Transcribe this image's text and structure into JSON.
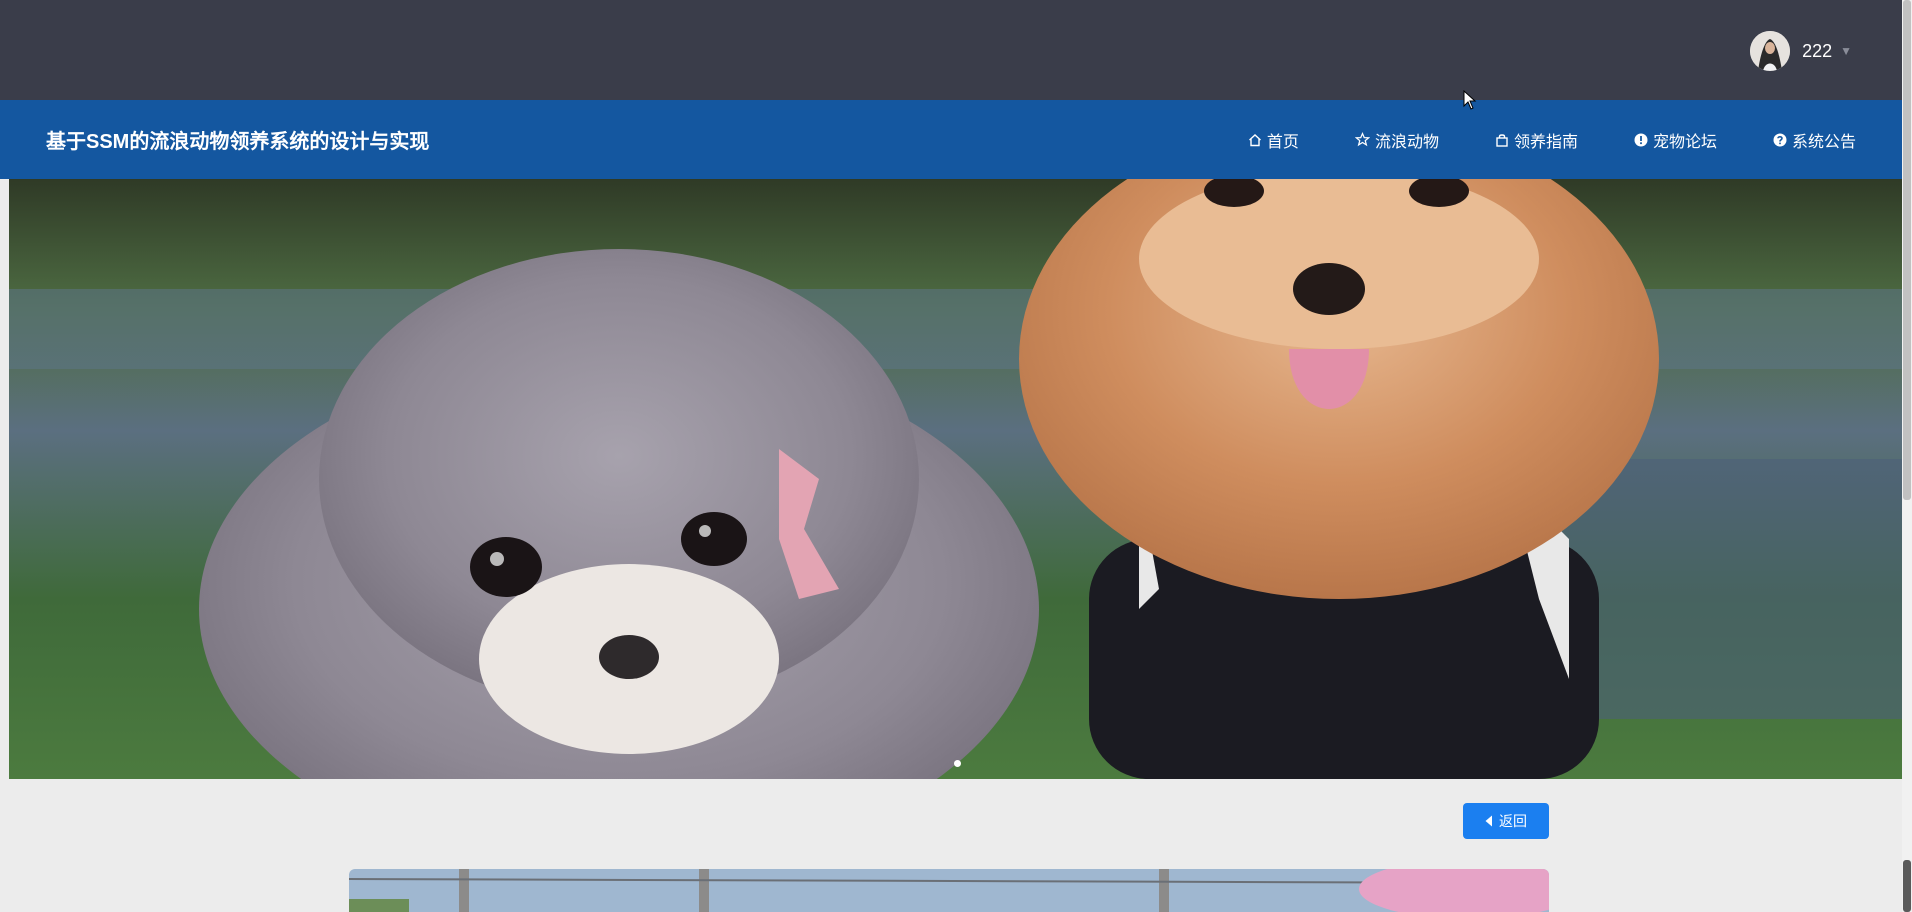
{
  "header": {
    "username": "222"
  },
  "navbar": {
    "site_title": "基于SSM的流浪动物领养系统的设计与实现",
    "items": [
      {
        "label": "首页",
        "icon": "home-icon"
      },
      {
        "label": "流浪动物",
        "icon": "star-icon"
      },
      {
        "label": "领养指南",
        "icon": "bag-icon"
      },
      {
        "label": "宠物论坛",
        "icon": "exclamation-icon"
      },
      {
        "label": "系统公告",
        "icon": "question-icon"
      }
    ]
  },
  "banner": {
    "active_slide": 1,
    "slide_count": 1
  },
  "actions": {
    "back_label": "返回",
    "back_icon": "caret-left-icon"
  },
  "colors": {
    "topbar": "#3a3d4a",
    "navbar": "#1457a0",
    "button": "#1b7ff0"
  }
}
